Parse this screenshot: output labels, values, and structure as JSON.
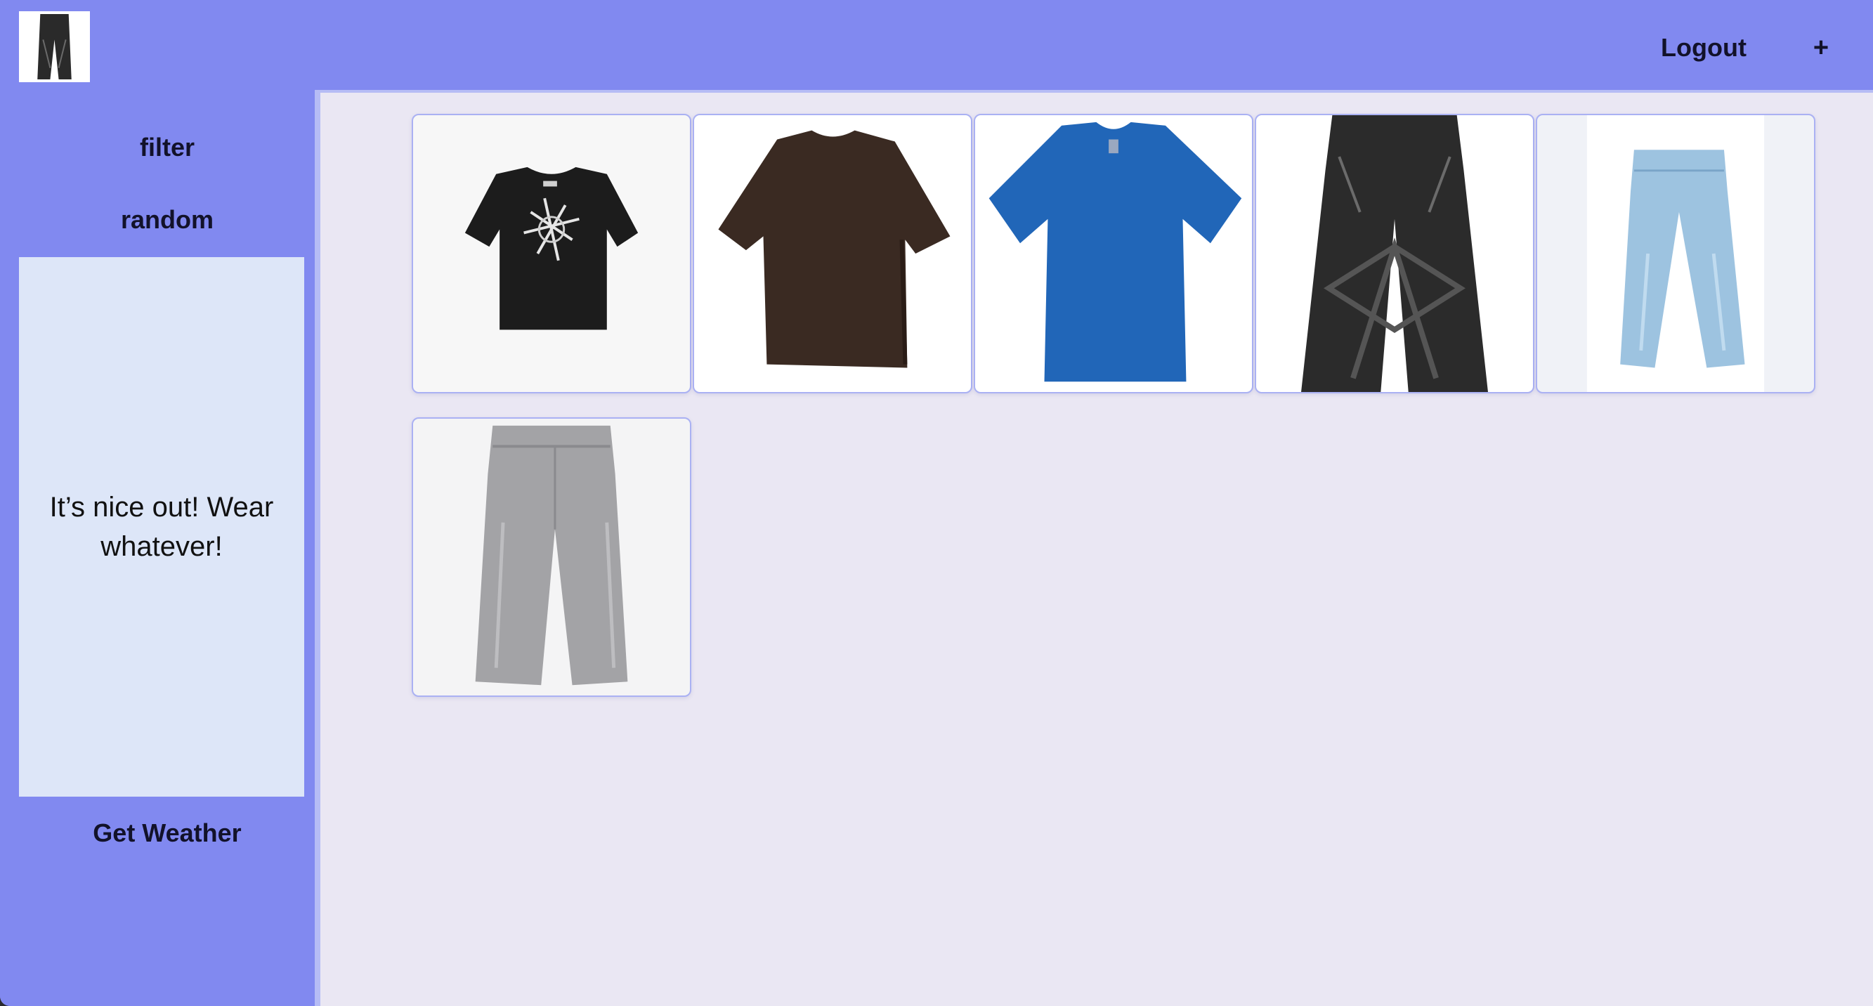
{
  "header": {
    "logo_icon": "jeans-thumbnail-icon",
    "logout_label": "Logout",
    "add_label": "+"
  },
  "sidebar": {
    "filter_label": "filter",
    "random_label": "random",
    "weather_message": "It’s nice out! Wear whatever!",
    "get_weather_label": "Get Weather"
  },
  "closet": {
    "items": [
      {
        "icon": "black-graphic-tshirt-icon",
        "color": "#1c1c1c"
      },
      {
        "icon": "brown-tshirt-icon",
        "color": "#3a2a22"
      },
      {
        "icon": "blue-tshirt-icon",
        "color": "#2166b8"
      },
      {
        "icon": "black-star-jeans-icon",
        "color": "#2b2b2b"
      },
      {
        "icon": "light-blue-jeans-icon",
        "color": "#9dc3e0"
      },
      {
        "icon": "grey-jeans-icon",
        "color": "#a3a3a6"
      }
    ]
  },
  "colors": {
    "accent": "#8189f0",
    "content_background": "#eae7f3",
    "weather_panel": "#dde6f8"
  }
}
